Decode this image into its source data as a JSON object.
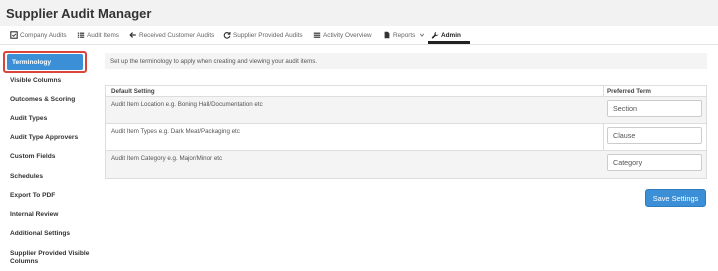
{
  "app": {
    "title": "Supplier Audit Manager"
  },
  "nav": [
    {
      "label": "Company Audits",
      "icon": "clipboard-check-icon"
    },
    {
      "label": "Audit Items",
      "icon": "list-icon"
    },
    {
      "label": "Received Customer Audits",
      "icon": "arrow-left-icon"
    },
    {
      "label": "Supplier Provided Audits",
      "icon": "refresh-icon"
    },
    {
      "label": "Activity Overview",
      "icon": "menu-icon"
    },
    {
      "label": "Reports",
      "icon": "document-icon"
    },
    {
      "label": "Admin",
      "icon": "wrench-icon",
      "active": true
    }
  ],
  "sidebar": {
    "active": "Terminology",
    "items": [
      "Visible Columns",
      "Outcomes & Scoring",
      "Audit Types",
      "Audit Type Approvers",
      "Custom Fields",
      "Schedules",
      "Export To PDF",
      "Internal Review",
      "Additional Settings",
      "Supplier Provided Visible Columns"
    ]
  },
  "main": {
    "info": "Set up the terminology to apply when creating and viewing your audit items.",
    "headers": {
      "default": "Default Setting",
      "preferred": "Preferred Term"
    },
    "rows": [
      {
        "default": "Audit Item Location e.g. Boning Hall/Documentation etc",
        "preferred": "Section"
      },
      {
        "default": "Audit Item Types e.g. Dark Meat/Packaging etc",
        "preferred": "Clause"
      },
      {
        "default": "Audit Item Category e.g. Major/Minor etc",
        "preferred": "Category"
      }
    ],
    "save_label": "Save Settings"
  }
}
